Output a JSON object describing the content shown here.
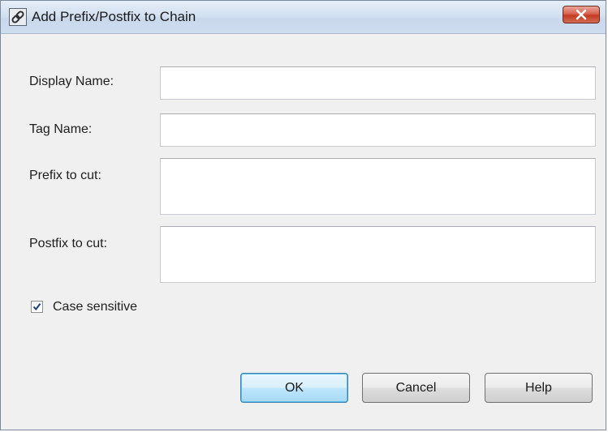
{
  "window": {
    "title": "Add Prefix/Postfix to Chain",
    "icon": "chain-link-icon"
  },
  "form": {
    "display_name": {
      "label": "Display Name:",
      "value": ""
    },
    "tag_name": {
      "label": "Tag Name:",
      "value": ""
    },
    "prefix": {
      "label": "Prefix to cut:",
      "value": ""
    },
    "postfix": {
      "label": "Postfix to cut:",
      "value": ""
    },
    "case_sensitive": {
      "label": "Case sensitive",
      "checked": true
    }
  },
  "buttons": {
    "ok": "OK",
    "cancel": "Cancel",
    "help": "Help"
  },
  "colors": {
    "titlebar": "#d4e1f1",
    "close_button": "#c94a34",
    "dialog_background": "#f0f0f0",
    "default_button_border": "#3c7fb1"
  }
}
